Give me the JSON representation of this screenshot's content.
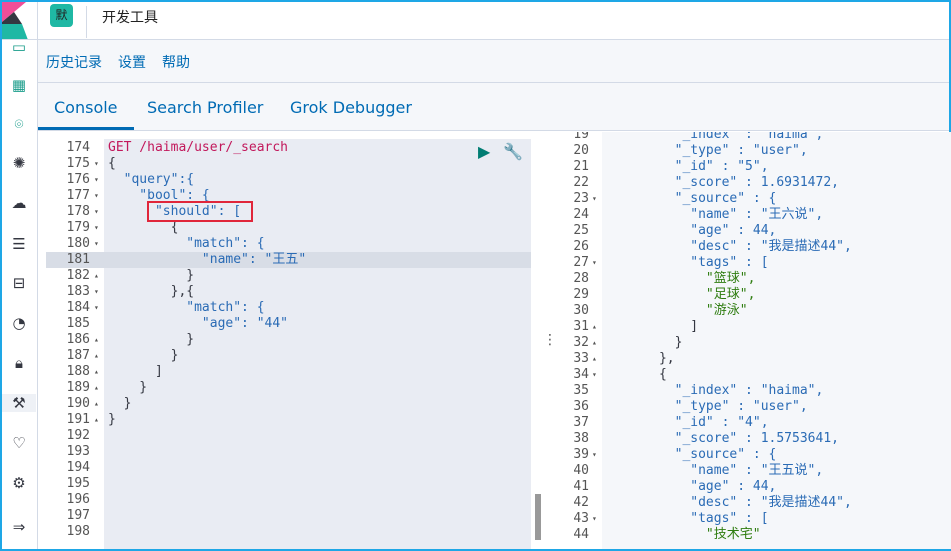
{
  "header": {
    "badge": "默",
    "title": "开发工具"
  },
  "menu": {
    "items": [
      "历史记录",
      "设置",
      "帮助"
    ]
  },
  "tabs": [
    {
      "label": "Console",
      "active": true
    },
    {
      "label": "Search Profiler"
    },
    {
      "label": "Grok Debugger"
    }
  ],
  "sidebar": {
    "icons": [
      "dashboard-icon",
      "canvas-icon",
      "maps-icon",
      "ml-icon",
      "infra-icon",
      "logs-icon",
      "apm-icon",
      "uptime-icon",
      "security-icon",
      "devtools-icon",
      "monitoring-icon",
      "management-icon",
      "collapse-icon"
    ]
  },
  "colors": {
    "accent": "#006bb4",
    "badge": "#1fb8a4",
    "highlight_box": "#e0263a",
    "string": "#3b8a14",
    "key": "#2a6bb5",
    "method": "#d6276b"
  },
  "request_editor": {
    "highlighted_line": 181,
    "lines": [
      {
        "n": 174,
        "t": "GET /haima/user/_search"
      },
      {
        "n": 175,
        "f": "▾",
        "t": "{"
      },
      {
        "n": 176,
        "f": "▾",
        "t": "  \"query\":{"
      },
      {
        "n": 177,
        "f": "▾",
        "t": "    \"bool\": {"
      },
      {
        "n": 178,
        "f": "▾",
        "t": "      \"should\": ["
      },
      {
        "n": 179,
        "f": "▾",
        "t": "        {"
      },
      {
        "n": 180,
        "f": "▾",
        "t": "          \"match\": {"
      },
      {
        "n": 181,
        "t": "            \"name\": \"王五\""
      },
      {
        "n": 182,
        "f": "▴",
        "t": "          }"
      },
      {
        "n": 183,
        "f": "▾",
        "t": "        },{"
      },
      {
        "n": 184,
        "f": "▾",
        "t": "          \"match\": {"
      },
      {
        "n": 185,
        "t": "            \"age\": \"44\""
      },
      {
        "n": 186,
        "f": "▴",
        "t": "          }"
      },
      {
        "n": 187,
        "f": "▴",
        "t": "        }"
      },
      {
        "n": 188,
        "f": "▴",
        "t": "      ]"
      },
      {
        "n": 189,
        "f": "▴",
        "t": "    }"
      },
      {
        "n": 190,
        "f": "▴",
        "t": "  }"
      },
      {
        "n": 191,
        "f": "▴",
        "t": "}"
      },
      {
        "n": 192,
        "t": ""
      },
      {
        "n": 193,
        "t": ""
      },
      {
        "n": 194,
        "t": ""
      },
      {
        "n": 195,
        "t": ""
      },
      {
        "n": 196,
        "t": ""
      },
      {
        "n": 197,
        "t": ""
      },
      {
        "n": 198,
        "t": ""
      }
    ]
  },
  "response_editor": {
    "lines": [
      {
        "n": 19,
        "t": "        \"_index\" : \"haima\","
      },
      {
        "n": 20,
        "t": "        \"_type\" : \"user\","
      },
      {
        "n": 21,
        "t": "        \"_id\" : \"5\","
      },
      {
        "n": 22,
        "t": "        \"_score\" : 1.6931472,"
      },
      {
        "n": 23,
        "f": "▾",
        "t": "        \"_source\" : {"
      },
      {
        "n": 24,
        "t": "          \"name\" : \"王六说\","
      },
      {
        "n": 25,
        "t": "          \"age\" : 44,"
      },
      {
        "n": 26,
        "t": "          \"desc\" : \"我是描述44\","
      },
      {
        "n": 27,
        "f": "▾",
        "t": "          \"tags\" : ["
      },
      {
        "n": 28,
        "t": "            \"篮球\","
      },
      {
        "n": 29,
        "t": "            \"足球\","
      },
      {
        "n": 30,
        "t": "            \"游泳\""
      },
      {
        "n": 31,
        "f": "▴",
        "t": "          ]"
      },
      {
        "n": 32,
        "f": "▴",
        "t": "        }"
      },
      {
        "n": 33,
        "f": "▴",
        "t": "      },"
      },
      {
        "n": 34,
        "f": "▾",
        "t": "      {"
      },
      {
        "n": 35,
        "t": "        \"_index\" : \"haima\","
      },
      {
        "n": 36,
        "t": "        \"_type\" : \"user\","
      },
      {
        "n": 37,
        "t": "        \"_id\" : \"4\","
      },
      {
        "n": 38,
        "t": "        \"_score\" : 1.5753641,"
      },
      {
        "n": 39,
        "f": "▾",
        "t": "        \"_source\" : {"
      },
      {
        "n": 40,
        "t": "          \"name\" : \"王五说\","
      },
      {
        "n": 41,
        "t": "          \"age\" : 44,"
      },
      {
        "n": 42,
        "t": "          \"desc\" : \"我是描述44\","
      },
      {
        "n": 43,
        "f": "▾",
        "t": "          \"tags\" : ["
      },
      {
        "n": 44,
        "t": "            \"技术宅\""
      }
    ]
  }
}
